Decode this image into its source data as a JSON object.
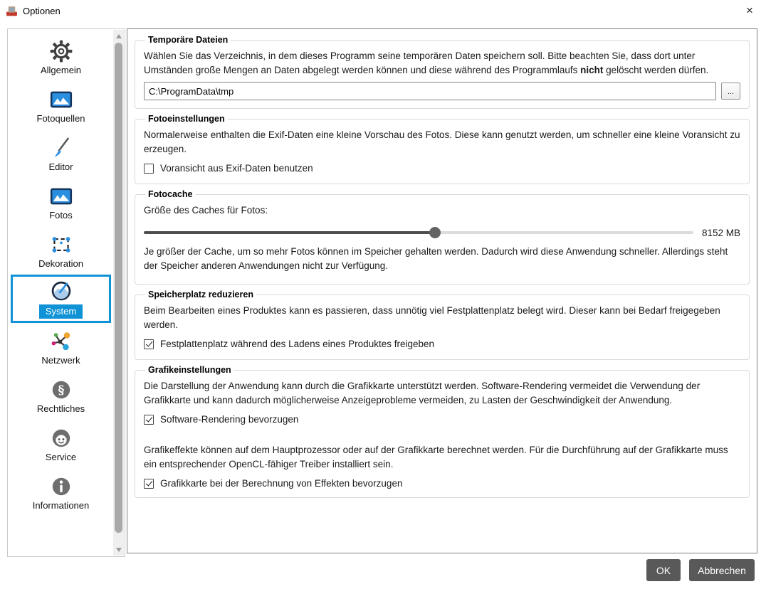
{
  "window": {
    "title": "Optionen",
    "close_label": "×"
  },
  "colors": {
    "accent": "#0f93d6",
    "button_gray": "#595959",
    "icon_blue": "#2b8fe0"
  },
  "sidebar": {
    "selected": "System",
    "items": [
      {
        "label": "Allgemein",
        "icon": "gear-icon"
      },
      {
        "label": "Fotoquellen",
        "icon": "photo-icon"
      },
      {
        "label": "Editor",
        "icon": "brush-icon"
      },
      {
        "label": "Fotos",
        "icon": "photo-icon"
      },
      {
        "label": "Dekoration",
        "icon": "selection-icon"
      },
      {
        "label": "System",
        "icon": "gauge-icon",
        "selected": true
      },
      {
        "label": "Netzwerk",
        "icon": "network-icon"
      },
      {
        "label": "Rechtliches",
        "icon": "paragraph-icon"
      },
      {
        "label": "Service",
        "icon": "support-icon"
      },
      {
        "label": "Informationen",
        "icon": "info-icon"
      }
    ]
  },
  "groups": {
    "temp": {
      "title": "Temporäre Dateien",
      "desc_before": "Wählen Sie das Verzeichnis, in dem dieses Programm seine temporären Daten speichern soll. Bitte beachten Sie, dass dort unter Umständen große Mengen an Daten abgelegt werden können und diese während des Programmlaufs ",
      "desc_bold": "nicht",
      "desc_after": " gelöscht werden dürfen.",
      "path_value": "C:\\ProgramData\\tmp",
      "browse_label": "..."
    },
    "photo": {
      "title": "Fotoeinstellungen",
      "desc": "Normalerweise enthalten die Exif-Daten eine kleine Vorschau des Fotos. Diese kann genutzt werden, um schneller eine kleine Voransicht zu erzeugen.",
      "checkbox": {
        "label": "Voransicht aus Exif-Daten benutzen",
        "checked": false
      }
    },
    "cache": {
      "title": "Fotocache",
      "label": "Größe des Caches für Fotos:",
      "slider": {
        "value_label": "8152 MB",
        "percent": 53
      },
      "desc": "Je größer der Cache, um so mehr Fotos können im Speicher gehalten werden. Dadurch wird diese Anwendung schneller. Allerdings steht der Speicher anderen Anwendungen nicht zur Verfügung."
    },
    "disk": {
      "title": "Speicherplatz reduzieren",
      "desc": "Beim Bearbeiten eines Produktes kann es passieren, dass unnötig viel Festplattenplatz belegt wird. Dieser kann bei Bedarf freigegeben werden.",
      "checkbox": {
        "label": "Festplattenplatz während des Ladens eines Produktes freigeben",
        "checked": true
      }
    },
    "graphics": {
      "title": "Grafikeinstellungen",
      "desc1": "Die Darstellung der Anwendung kann durch die Grafikkarte unterstützt werden. Software-Rendering vermeidet die Verwendung der Grafikkarte und kann dadurch möglicherweise Anzeigeprobleme vermeiden, zu Lasten der Geschwindigkeit der Anwendung.",
      "checkbox1": {
        "label": "Software-Rendering bevorzugen",
        "checked": true
      },
      "desc2": "Grafikeffekte können auf dem Hauptprozessor oder auf der Grafikkarte berechnet werden. Für die Durchführung auf der Grafikkarte muss ein entsprechender OpenCL-fähiger Treiber installiert sein.",
      "checkbox2": {
        "label": "Grafikkarte bei der Berechnung von Effekten bevorzugen",
        "checked": true
      }
    }
  },
  "footer": {
    "ok_label": "OK",
    "cancel_label": "Abbrechen"
  }
}
